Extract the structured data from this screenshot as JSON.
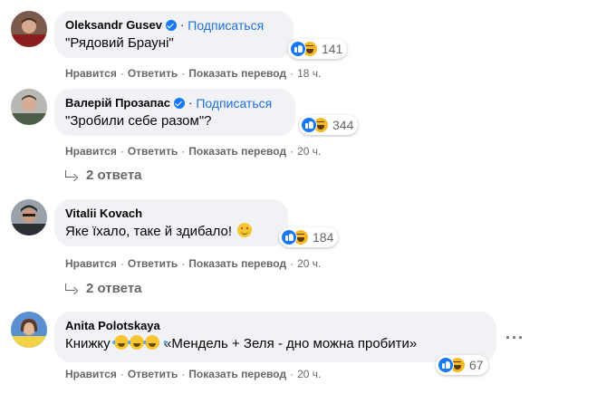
{
  "comments": [
    {
      "author": "Oleksandr Gusev",
      "verified": true,
      "follow_label": "Подписаться",
      "text": "\"Рядовий Брауні\"",
      "reaction_count": "141",
      "actions": {
        "like": "Нравится",
        "reply": "Ответить",
        "translate": "Показать перевод",
        "time": "18 ч."
      }
    },
    {
      "author": "Валерій Прозапас",
      "verified": true,
      "follow_label": "Подписаться",
      "text": "\"Зробили себе разом\"?",
      "reaction_count": "344",
      "actions": {
        "like": "Нравится",
        "reply": "Ответить",
        "translate": "Показать перевод",
        "time": "20 ч."
      },
      "replies_label": "2 ответа"
    },
    {
      "author": "Vitalii Kovach",
      "text": "Яке їхало, таке й здибало!",
      "reaction_count": "184",
      "actions": {
        "like": "Нравится",
        "reply": "Ответить",
        "translate": "Показать перевод",
        "time": "20 ч."
      },
      "replies_label": "2 ответа"
    },
    {
      "author": "Anita Polotskaya",
      "text_before": "Книжку",
      "text_after": "«Мендель + Зеля - дно можна пробити»",
      "reaction_count": "67",
      "actions": {
        "like": "Нравится",
        "reply": "Ответить",
        "translate": "Показать перевод",
        "time": "20 ч."
      }
    }
  ],
  "separator": "·",
  "colors": {
    "bubble": "#f0f2f5",
    "link": "#216fdb",
    "meta": "#65676b",
    "verified": "#1877f2",
    "like": "#1877f2",
    "haha": "#f7b928"
  },
  "icons": [
    "verified-badge-icon",
    "like-reaction-icon",
    "haha-reaction-icon",
    "reply-arrow-icon",
    "smile-emoji-icon",
    "tears-of-joy-emoji-icon",
    "more-options-icon"
  ]
}
